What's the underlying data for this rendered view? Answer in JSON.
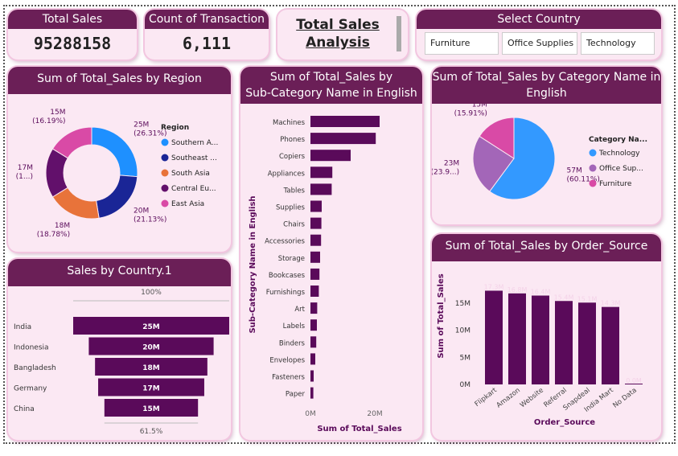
{
  "kpi_total_sales": {
    "title": "Total Sales",
    "value": "95288158"
  },
  "kpi_count": {
    "title": "Count of Transaction",
    "value": "6,111"
  },
  "dashboard_title": {
    "line1": "Total Sales",
    "line2": "Analysis"
  },
  "country_slicer": {
    "title": "Select Country",
    "options": [
      "Furniture",
      "Office Supplies",
      "Technology"
    ]
  },
  "colors": {
    "header": "#6b1f57",
    "card_bg": "#fbe8f3",
    "bar": "#5a0a5a",
    "blue": "#1e90ff",
    "navy": "#1a2596",
    "orange": "#e8733a",
    "purple": "#62106b",
    "pink": "#d94aa6",
    "lilac": "#a366b8"
  },
  "region_donut": {
    "title": "Sum of Total_Sales by Region",
    "legend_title": "Region",
    "chart_data": {
      "type": "pie",
      "categories": [
        "Southern A...",
        "Southeast ...",
        "South Asia",
        "Central Eu...",
        "East Asia"
      ],
      "values": [
        26.31,
        21.13,
        18.78,
        17.59,
        16.19
      ],
      "labels": [
        [
          "25M",
          "(26.31%)"
        ],
        [
          "20M",
          "(21.13%)"
        ],
        [
          "18M",
          "(18.78%)"
        ],
        [
          "17M",
          "(1...)"
        ],
        [
          "15M",
          "(16.19%)"
        ]
      ],
      "colors": [
        "#1e90ff",
        "#1a2596",
        "#e8733a",
        "#62106b",
        "#d94aa6"
      ]
    }
  },
  "subcat_bar": {
    "title_line1": "Sum of Total_Sales by",
    "title_line2": "Sub-Category Name in English",
    "ylabel": "Sub-Category Name in English",
    "xlabel": "Sum of Total_Sales",
    "chart_data": {
      "type": "bar",
      "categories": [
        "Machines",
        "Phones",
        "Copiers",
        "Appliances",
        "Tables",
        "Supplies",
        "Chairs",
        "Accessories",
        "Storage",
        "Bookcases",
        "Furnishings",
        "Art",
        "Labels",
        "Binders",
        "Envelopes",
        "Fasteners",
        "Paper"
      ],
      "values": [
        21.5,
        20.3,
        12.5,
        6.8,
        6.6,
        3.5,
        3.4,
        3.3,
        3.0,
        2.8,
        2.6,
        2.1,
        2.0,
        1.8,
        1.5,
        1.0,
        0.9
      ],
      "xticks": [
        "0M",
        "20M"
      ],
      "xlim": [
        0,
        30
      ]
    }
  },
  "category_pie": {
    "title_line1": "Sum of Total_Sales by Category Name in",
    "title_line2": "English",
    "legend_title": "Category Na...",
    "chart_data": {
      "type": "pie",
      "categories": [
        "Technology",
        "Office Sup...",
        "Furniture"
      ],
      "values": [
        60.11,
        23.98,
        15.91
      ],
      "labels": [
        [
          "57M",
          "(60.11%)"
        ],
        [
          "23M",
          "(23.9...)"
        ],
        [
          "15M",
          "(15.91%)"
        ]
      ],
      "colors": [
        "#3399ff",
        "#a366b8",
        "#d94aa6"
      ]
    }
  },
  "country_funnel": {
    "title": "Sales by Country.1",
    "top_label": "100%",
    "bottom_label": "61.5%",
    "chart_data": {
      "type": "bar",
      "categories": [
        "India",
        "Indonesia",
        "Bangladesh",
        "Germany",
        "China"
      ],
      "values": [
        25,
        20,
        18,
        17,
        15
      ],
      "value_labels": [
        "25M",
        "20M",
        "18M",
        "17M",
        "15M"
      ]
    }
  },
  "order_source": {
    "title": "Sum of Total_Sales by Order_Source",
    "ylabel": "Sum of Total_Sales",
    "xlabel": "Order_Source",
    "chart_data": {
      "type": "bar",
      "categories": [
        "Flipkart",
        "Amazon",
        "Website",
        "Referral",
        "Snapdeal",
        "India Mart",
        "No Data"
      ],
      "values": [
        17.3,
        16.8,
        16.4,
        15.4,
        15.1,
        14.3,
        0.0
      ],
      "value_labels": [
        "17.3M",
        "16.8M",
        "16.4M",
        "15.4M",
        "15.1M",
        "14.3M",
        "0.0M"
      ],
      "yticks": [
        "0M",
        "5M",
        "10M",
        "15M"
      ],
      "ytick_values": [
        0,
        5,
        10,
        15
      ],
      "ylim": [
        0,
        19
      ]
    }
  }
}
